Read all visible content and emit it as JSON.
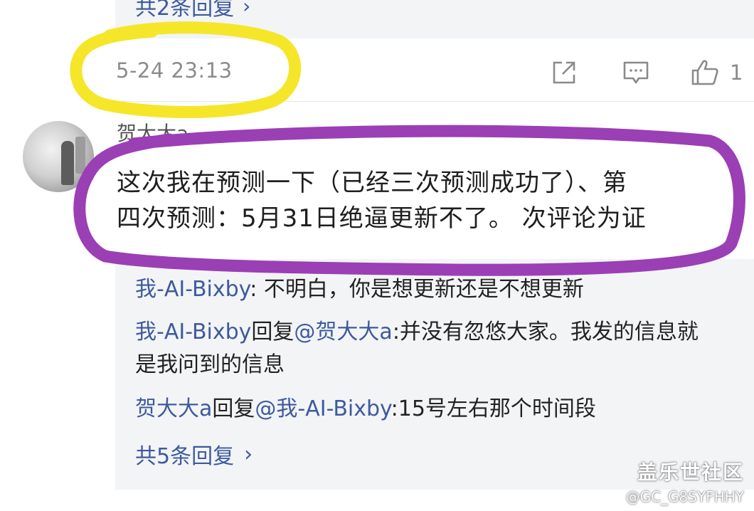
{
  "previous": {
    "replies_link": "共2条回复"
  },
  "meta": {
    "timestamp": "5-24 23:13",
    "like_count": "1"
  },
  "comment": {
    "username": "贺大大a",
    "lines": [
      "这次我在预测一下（已经三次预测成功了）、第",
      "四次预测：5月31日绝逼更新不了。 次评论为证"
    ]
  },
  "replies": [
    {
      "name": "我-AI-Bixby",
      "text": ": 不明白，你是想更新还是不想更新"
    },
    {
      "name": "我-AI-Bixby",
      "verb": "回复",
      "target": "@贺大大a",
      "text": ":并没有忽悠大家。我发的信息就是我问到的信息"
    },
    {
      "name": "贺大大a",
      "verb": "回复",
      "target": "@我-AI-Bixby",
      "text": ":15号左右那个时间段"
    }
  ],
  "more_replies": "共5条回复",
  "icons": [
    "share-icon",
    "comment-icon",
    "like-icon",
    "chevron-right-icon"
  ],
  "colors": {
    "link": "#3d5a9e",
    "highlight_yellow": "#f5e62a",
    "highlight_purple": "#9b3fb5"
  },
  "watermark": {
    "brand": "盖乐世社区",
    "user": "@GC_G8SYFHHY"
  }
}
